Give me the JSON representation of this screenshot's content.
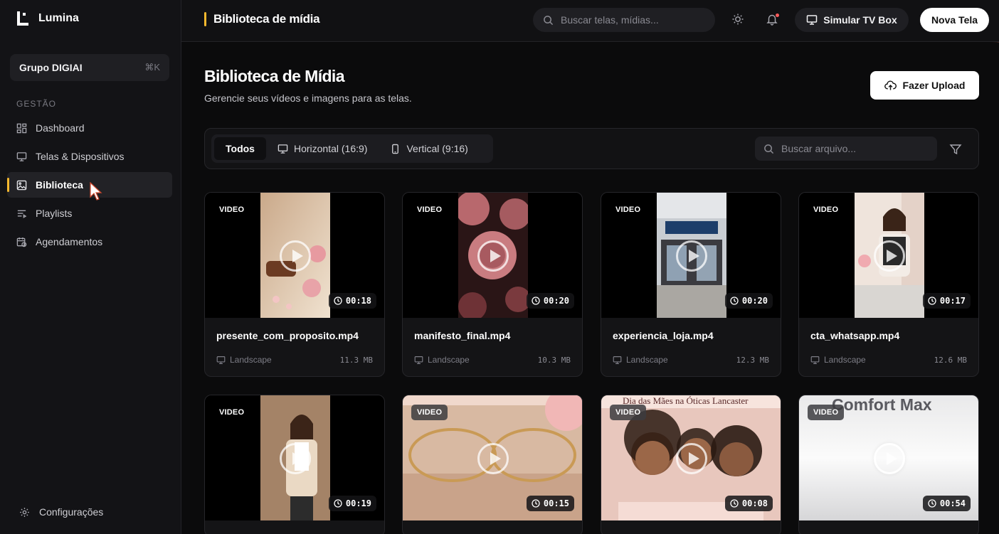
{
  "brand": {
    "name": "Lumina"
  },
  "sidebar": {
    "org": {
      "name": "Grupo DIGIAI",
      "shortcut": "⌘K"
    },
    "section_label": "GESTÃO",
    "items": [
      {
        "label": "Dashboard",
        "icon": "dashboard-icon"
      },
      {
        "label": "Telas & Dispositivos",
        "icon": "monitor-icon"
      },
      {
        "label": "Biblioteca",
        "icon": "image-icon",
        "active": true
      },
      {
        "label": "Playlists",
        "icon": "playlist-icon"
      },
      {
        "label": "Agendamentos",
        "icon": "calendar-clock-icon"
      }
    ],
    "settings_label": "Configurações"
  },
  "topbar": {
    "title": "Biblioteca de mídia",
    "search_placeholder": "Buscar telas, mídias...",
    "tvbox_label": "Simular TV Box",
    "new_screen_label": "Nova Tela"
  },
  "page": {
    "title": "Biblioteca de Mídia",
    "subtitle": "Gerencie seus vídeos e imagens para as telas.",
    "upload_label": "Fazer Upload"
  },
  "filters": {
    "tabs": [
      {
        "label": "Todos",
        "active": true
      },
      {
        "label": "Horizontal (16:9)",
        "icon": "monitor-icon"
      },
      {
        "label": "Vertical (9:16)",
        "icon": "phone-icon"
      }
    ],
    "search_placeholder": "Buscar arquivo..."
  },
  "media": [
    {
      "tag": "VIDEO",
      "duration": "00:18",
      "name": "presente_com_proposito.mp4",
      "orientation": "Landscape",
      "size": "11.3 MB"
    },
    {
      "tag": "VIDEO",
      "duration": "00:20",
      "name": "manifesto_final.mp4",
      "orientation": "Landscape",
      "size": "10.3 MB"
    },
    {
      "tag": "VIDEO",
      "duration": "00:20",
      "name": "experiencia_loja.mp4",
      "orientation": "Landscape",
      "size": "12.3 MB"
    },
    {
      "tag": "VIDEO",
      "duration": "00:17",
      "name": "cta_whatsapp.mp4",
      "orientation": "Landscape",
      "size": "12.6 MB"
    },
    {
      "tag": "VIDEO",
      "duration": "00:19"
    },
    {
      "tag": "VIDEO",
      "duration": "00:15"
    },
    {
      "tag": "VIDEO",
      "duration": "00:08",
      "thumb_text": "Dia das Mães na Óticas Lancaster"
    },
    {
      "tag": "VIDEO",
      "duration": "00:54",
      "thumb_text": "Comfort Max"
    }
  ],
  "colors": {
    "accent": "#f5b82e",
    "background": "#0b0b0c",
    "sidebar": "#131316"
  }
}
